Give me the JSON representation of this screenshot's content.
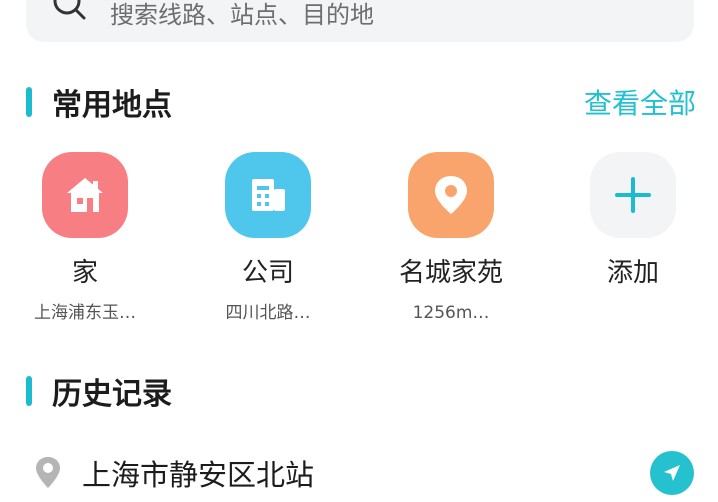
{
  "search": {
    "placeholder": "搜索线路、站点、目的地"
  },
  "favorites": {
    "title": "常用地点",
    "view_all": "查看全部",
    "items": [
      {
        "label": "家",
        "sub": "上海浦东玉…",
        "icon": "home-icon",
        "color": "#f77f83"
      },
      {
        "label": "公司",
        "sub": "四川北路…",
        "icon": "building-icon",
        "color": "#4fc6ec"
      },
      {
        "label": "名城家苑",
        "sub": "1256m…",
        "icon": "location-pin-icon",
        "color": "#f9a46c"
      },
      {
        "label": "添加",
        "sub": "",
        "icon": "plus-icon",
        "color": "#f3f4f5"
      }
    ]
  },
  "history": {
    "title": "历史记录",
    "items": [
      {
        "text": "上海市静安区北站",
        "icon": "location-pin-icon",
        "action_icon": "navigate-arrow-icon"
      }
    ]
  },
  "accent_color": "#1cbcd0"
}
